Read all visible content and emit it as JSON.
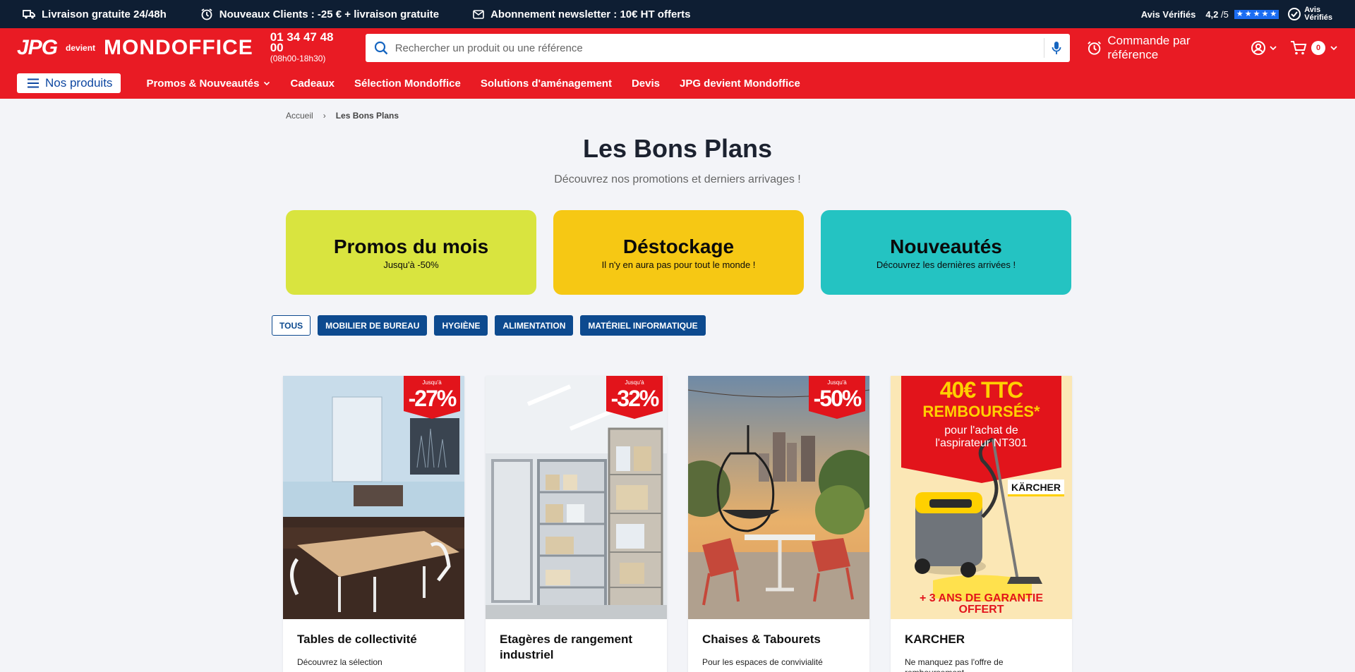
{
  "topbar": {
    "promos": [
      {
        "text": "Livraison gratuite 24/48h",
        "icon": "truck-icon"
      },
      {
        "text": "Nouveaux Clients : -25 € + livraison gratuite",
        "icon": "alarm-clock-icon"
      },
      {
        "text": "Abonnement newsletter : 10€ HT offerts",
        "icon": "mail-icon"
      }
    ],
    "reviews_label": "Avis Vérifiés",
    "rating": "4,2",
    "rating_scale": "/5",
    "av_logo_line1": "Avis",
    "av_logo_line2": "Vérifiés"
  },
  "header": {
    "logo_jpg": "JPG",
    "logo_devient": "devient",
    "logo_mondo": "MONDOFFICE",
    "phone": "01 34 47 48 00",
    "hours": "(08h00-18h30)",
    "search_placeholder": "Rechercher un produit ou une référence",
    "command_ref": "Commande par référence",
    "cart_count": "0"
  },
  "nav": {
    "nos_produits": "Nos produits",
    "items": [
      "Promos & Nouveautés",
      "Cadeaux",
      "Sélection Mondoffice",
      "Solutions d'aménagement",
      "Devis",
      "JPG devient Mondoffice"
    ]
  },
  "breadcrumb": {
    "home": "Accueil",
    "separator": "›",
    "current": "Les Bons Plans"
  },
  "page": {
    "title": "Les Bons Plans",
    "subtitle": "Découvrez nos promotions et derniers arrivages !"
  },
  "tiles": [
    {
      "title": "Promos du mois",
      "sub": "Jusqu'à -50%",
      "color": "#d9e43f"
    },
    {
      "title": "Déstockage",
      "sub": "Il n'y en aura pas pour tout le monde !",
      "color": "#f6c814"
    },
    {
      "title": "Nouveautés",
      "sub": "Découvrez les dernières arrivées !",
      "color": "#24c3c2"
    }
  ],
  "filters": [
    "TOUS",
    "MOBILIER DE BUREAU",
    "HYGIÈNE",
    "ALIMENTATION",
    "MATÉRIEL INFORMATIQUE"
  ],
  "cards": [
    {
      "title": "Tables de collectivité",
      "desc": "Découvrez la sélection",
      "ribbon_up": "Jusqu'à",
      "ribbon_pct": "-27%"
    },
    {
      "title": "Etagères de rangement industriel",
      "desc": "",
      "ribbon_up": "Jusqu'à",
      "ribbon_pct": "-32%"
    },
    {
      "title": "Chaises & Tabourets",
      "desc": "Pour les espaces de convivialité",
      "ribbon_up": "Jusqu'à",
      "ribbon_pct": "-50%"
    },
    {
      "title": "KARCHER",
      "desc": "Ne manquez pas l'offre de remboursement",
      "k_amount": "40€ TTC",
      "k_rembourses": "REMBOURSÉS*",
      "k_pour1": "pour l'achat de",
      "k_pour2": "l'aspirateur NT301",
      "k_brand": "KÄRCHER",
      "k_gar1": "+ 3 ANS DE GARANTIE",
      "k_gar2": "OFFERT"
    }
  ],
  "colors": {
    "brand_red": "#e91b24",
    "navy": "#0e1e33",
    "filter_blue": "#0d4a8f"
  }
}
